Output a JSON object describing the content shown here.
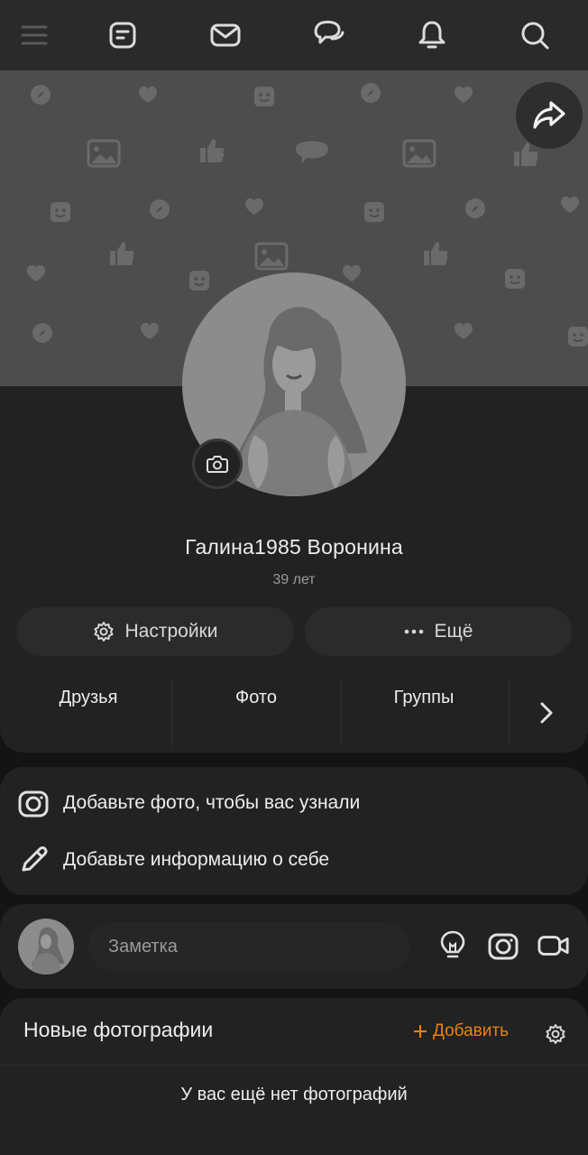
{
  "topbar": {
    "icons": [
      "menu-icon",
      "feed-icon",
      "mail-icon",
      "chat-icon",
      "bell-icon",
      "search-icon"
    ]
  },
  "cover": {
    "share_icon": "share-icon"
  },
  "profile": {
    "name": "Галина1985 Воронина",
    "age": "39 лет",
    "settings_label": "Настройки",
    "more_label": "Ещё"
  },
  "tabs": {
    "items": [
      {
        "label": "Друзья"
      },
      {
        "label": "Фото"
      },
      {
        "label": "Группы"
      }
    ]
  },
  "info": {
    "add_photo": "Добавьте фото, чтобы вас узнали",
    "add_info": "Добавьте информацию о себе"
  },
  "note": {
    "placeholder": "Заметка"
  },
  "photos": {
    "title": "Новые фотографии",
    "add_label": "Добавить",
    "empty_text": "У вас ещё нет фотографий"
  },
  "colors": {
    "accent": "#ee8208",
    "background": "#141414",
    "card": "#222222",
    "topbar": "#2a2a2a",
    "cover": "#4d4d4d"
  }
}
